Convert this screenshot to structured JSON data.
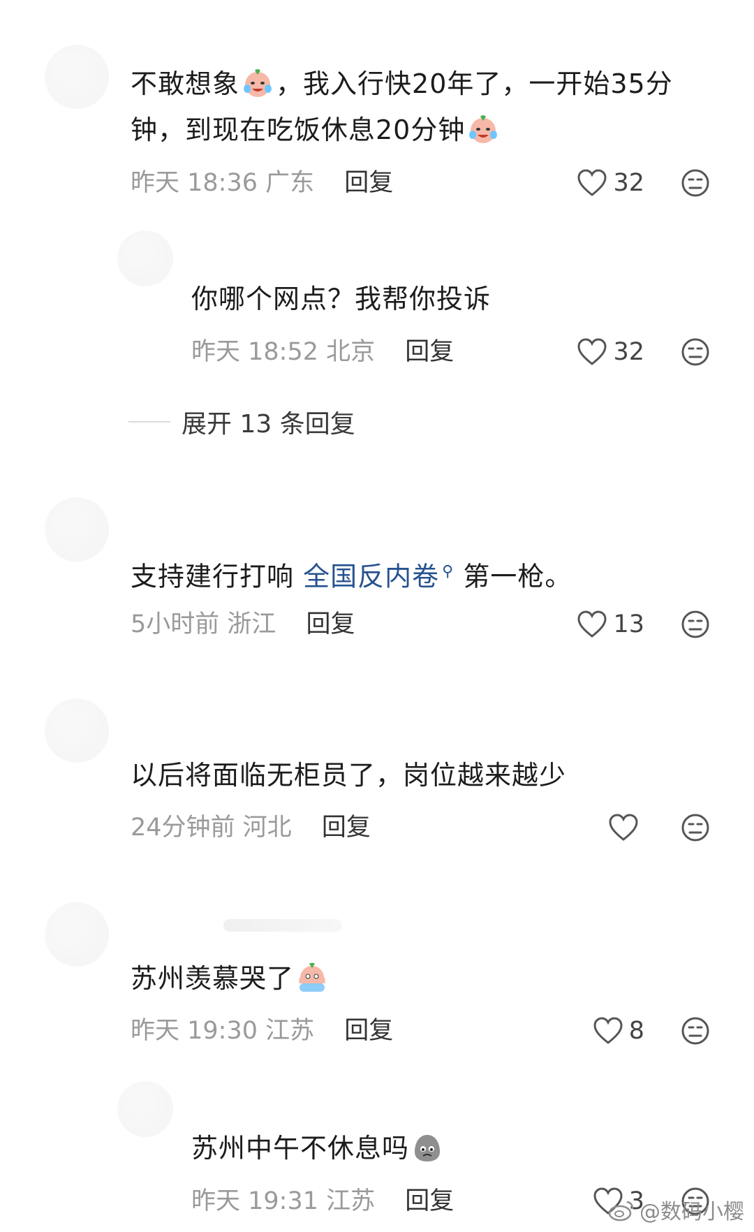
{
  "comments": [
    {
      "text_before": "不敢想象",
      "text_after": "，我入行快20年了，一开始35分钟，到现在吃饭休息20分钟",
      "emoji": "crying-laughing-emoji",
      "time": "昨天 18:36 广东",
      "reply_label": "回复",
      "likes": "32"
    },
    {
      "text": "你哪个网点？我帮你投诉",
      "time": "昨天 18:52 北京",
      "reply_label": "回复",
      "likes": "32"
    },
    {
      "text_before": "支持建行打响 ",
      "link": "全国反内卷",
      "text_after": " 第一枪。",
      "time": "5小时前 浙江",
      "reply_label": "回复",
      "likes": "13"
    },
    {
      "text": "以后将面临无柜员了，岗位越来越少",
      "time": "24分钟前 河北",
      "reply_label": "回复",
      "likes": ""
    },
    {
      "text": "苏州羡慕哭了",
      "emoji": "crying-hands-emoji",
      "time": "昨天 19:30 江苏",
      "reply_label": "回复",
      "likes": "8"
    },
    {
      "text": "苏州中午不休息吗",
      "emoji": "grey-sad-emoji",
      "time": "昨天 19:31 江苏",
      "reply_label": "回复",
      "likes": "3"
    }
  ],
  "expand_replies": "展开 13 条回复",
  "watermark": "@数码小樱",
  "colors": {
    "link": "#27528f",
    "meta": "#9a9a9a",
    "text": "#1c1c1c"
  }
}
